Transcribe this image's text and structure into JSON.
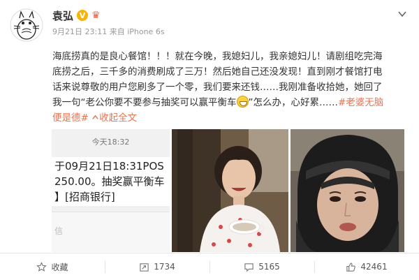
{
  "user": {
    "name": "袁弘",
    "verified_mark": "V",
    "vip_mark": "♛",
    "date": "9月21日 23:11",
    "source": "来自 iPhone 6s"
  },
  "post": {
    "line1": "海底捞真的是良心餐馆！！！就在今晚，我媳妇儿，我亲媳妇儿！请剧组吃完海",
    "line2": "底捞之后，三千多的消费刷成了三万！然后她自己还没发现！直到刚才餐馆打电",
    "line3": "话来说尊敬的用户您刷多了一个零，我们要来还钱……我刚准备收拾她，她回了",
    "line4_before_emoji": "我一句“老公你要不要参与抽奖可以赢平衡车",
    "line4_after_emoji": "”怎么办，心好累……",
    "hashtag_part1": "#老婆无脑",
    "hashtag_part2": "便是德#",
    "expand_label": "收起全文"
  },
  "sms": {
    "time": "今天18:32",
    "line1": "于09月21日18:31POS",
    "line2": "250.00。抽奖赢平衡车",
    "line3": "】[招商银行]",
    "input_hint": "信"
  },
  "actions": {
    "favorite_label": "收藏",
    "repost_count": "1734",
    "comment_count": "5165",
    "like_count": "42461"
  },
  "colors": {
    "accent": "#eb7350",
    "verified": "#f7b500"
  }
}
